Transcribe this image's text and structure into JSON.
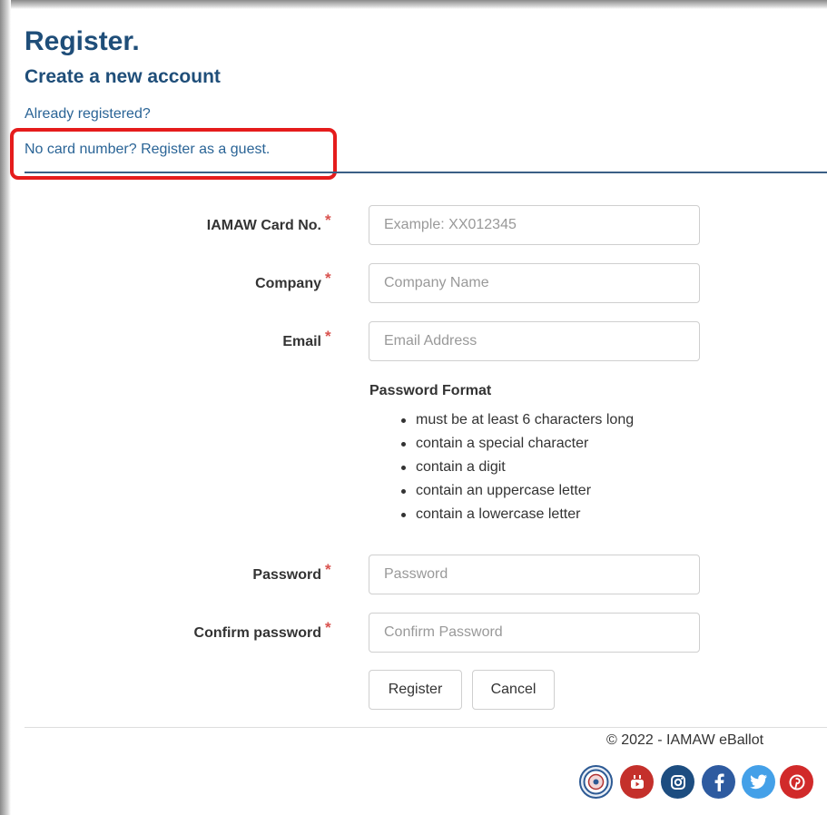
{
  "header": {
    "title": "Register.",
    "subtitle": "Create a new account",
    "login_link": "Already registered?",
    "guest_link": "No card number? Register as a guest."
  },
  "form": {
    "required_marker": "*",
    "fields": [
      {
        "label": "IAMAW Card No.",
        "placeholder": "Example: XX012345",
        "value": ""
      },
      {
        "label": "Company",
        "placeholder": "Company Name",
        "value": ""
      },
      {
        "label": "Email",
        "placeholder": "Email Address",
        "value": ""
      },
      {
        "label": "Password",
        "placeholder": "Password",
        "value": ""
      },
      {
        "label": "Confirm password",
        "placeholder": "Confirm Password",
        "value": ""
      }
    ],
    "password_format": {
      "title": "Password Format",
      "rules": [
        "must be at least 6 characters long",
        "contain a special character",
        "contain a digit",
        "contain an uppercase letter",
        "contain a lowercase letter"
      ]
    },
    "buttons": {
      "register": "Register",
      "cancel": "Cancel"
    }
  },
  "footer": {
    "copyright": "© 2022 - IAMAW eBallot",
    "social_icons": [
      "iamaw-logo-icon",
      "youtube-icon",
      "instagram-icon",
      "facebook-icon",
      "twitter-icon",
      "pinterest-icon"
    ]
  },
  "colors": {
    "heading": "#1f4e79",
    "link": "#2a6496",
    "required": "#d9534f",
    "highlight": "#e51c1c"
  }
}
